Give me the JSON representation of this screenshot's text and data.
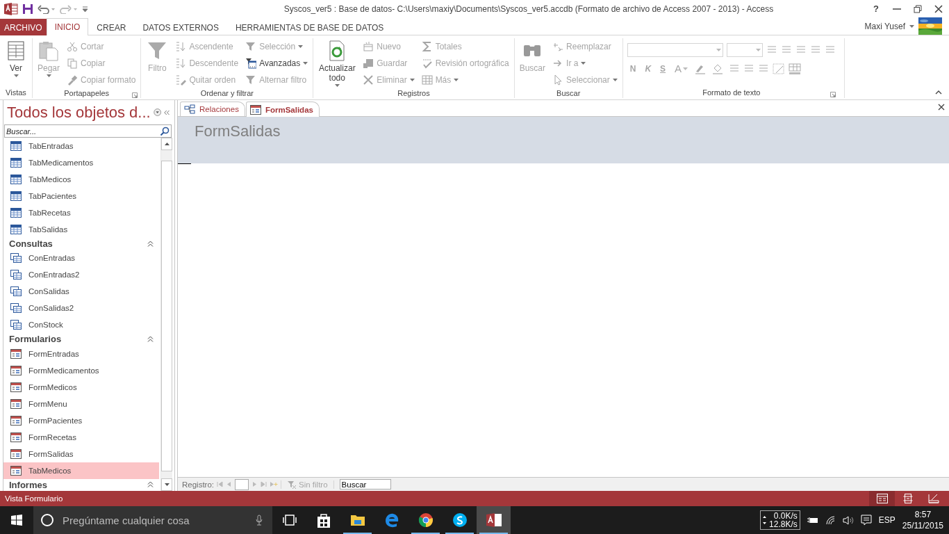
{
  "window": {
    "title": "Syscos_ver5 : Base de datos- C:\\Users\\maxiy\\Documents\\Syscos_ver5.accdb (Formato de archivo de Access 2007 - 2013) - Access",
    "help": "?"
  },
  "ribbon_tabs": [
    {
      "label": "ARCHIVO",
      "kind": "file",
      "selected": false
    },
    {
      "label": "INICIO",
      "kind": "tab",
      "selected": true
    },
    {
      "label": "CREAR",
      "kind": "tab",
      "selected": false
    },
    {
      "label": "DATOS EXTERNOS",
      "kind": "tab",
      "selected": false
    },
    {
      "label": "HERRAMIENTAS DE BASE DE DATOS",
      "kind": "tab",
      "selected": false
    }
  ],
  "user": {
    "name": "Maxi Yusef"
  },
  "ribbon_groups": [
    {
      "title": "Vistas",
      "launcher": false,
      "columns": [
        {
          "kind": "large",
          "items": [
            {
              "label": "Ver",
              "disabled": false,
              "dropdown": true
            }
          ]
        }
      ]
    },
    {
      "title": "Portapapeles",
      "launcher": true,
      "columns": [
        {
          "kind": "large",
          "items": [
            {
              "label": "Pegar",
              "disabled": true,
              "dropdown": true
            }
          ]
        },
        {
          "kind": "stack",
          "items": [
            {
              "label": "Cortar",
              "disabled": true,
              "dropdown": false
            },
            {
              "label": "Copiar",
              "disabled": true,
              "dropdown": false
            },
            {
              "label": "Copiar formato",
              "disabled": true,
              "dropdown": false
            }
          ]
        }
      ]
    },
    {
      "title": "Ordenar y filtrar",
      "launcher": false,
      "columns": [
        {
          "kind": "large",
          "items": [
            {
              "label": "Filtro",
              "disabled": true,
              "dropdown": false
            }
          ]
        },
        {
          "kind": "stack",
          "items": [
            {
              "label": "Ascendente",
              "disabled": true,
              "dropdown": false
            },
            {
              "label": "Descendente",
              "disabled": true,
              "dropdown": false
            },
            {
              "label": "Quitar orden",
              "disabled": true,
              "dropdown": false
            }
          ]
        },
        {
          "kind": "stack",
          "items": [
            {
              "label": "Selección",
              "disabled": true,
              "dropdown": true
            },
            {
              "label": "Avanzadas",
              "disabled": false,
              "dropdown": true
            },
            {
              "label": "Alternar filtro",
              "disabled": true,
              "dropdown": false
            }
          ]
        }
      ]
    },
    {
      "title": "Registros",
      "launcher": false,
      "columns": [
        {
          "kind": "large",
          "items": [
            {
              "label": "Actualizar todo",
              "disabled": false,
              "dropdown": true
            }
          ]
        },
        {
          "kind": "stack",
          "items": [
            {
              "label": "Nuevo",
              "disabled": true,
              "dropdown": false
            },
            {
              "label": "Guardar",
              "disabled": true,
              "dropdown": false
            },
            {
              "label": "Eliminar",
              "disabled": true,
              "dropdown": true
            }
          ]
        },
        {
          "kind": "stack",
          "items": [
            {
              "label": "Totales",
              "disabled": true,
              "dropdown": false
            },
            {
              "label": "Revisión ortográfica",
              "disabled": true,
              "dropdown": false
            },
            {
              "label": "Más",
              "disabled": true,
              "dropdown": true
            }
          ]
        }
      ]
    },
    {
      "title": "Buscar",
      "launcher": false,
      "columns": [
        {
          "kind": "large",
          "items": [
            {
              "label": "Buscar",
              "disabled": true,
              "dropdown": false
            }
          ]
        },
        {
          "kind": "stack",
          "items": [
            {
              "label": "Reemplazar",
              "disabled": true,
              "dropdown": false
            },
            {
              "label": "Ir a",
              "disabled": true,
              "dropdown": true
            },
            {
              "label": "Seleccionar",
              "disabled": true,
              "dropdown": true
            }
          ]
        }
      ]
    },
    {
      "title": "Formato de texto",
      "launcher": true,
      "columns": [
        {
          "kind": "format",
          "items": [
            {
              "label": "N",
              "disabled": true,
              "dropdown": false
            },
            {
              "label": "K",
              "disabled": true,
              "dropdown": false
            },
            {
              "label": "S",
              "disabled": true,
              "dropdown": false
            },
            {
              "label": "A",
              "disabled": true,
              "dropdown": true
            }
          ]
        }
      ]
    }
  ],
  "nav_pane": {
    "title": "Todos los objetos d...",
    "search": {
      "placeholder": "Buscar..."
    },
    "sections": [
      {
        "kind": "table",
        "items": [
          {
            "label": "TabEntradas",
            "selected": false
          },
          {
            "label": "TabMedicamentos",
            "selected": false
          },
          {
            "label": "TabMedicos",
            "selected": false
          },
          {
            "label": "TabPacientes",
            "selected": false
          },
          {
            "label": "TabRecetas",
            "selected": false
          },
          {
            "label": "TabSalidas",
            "selected": false
          }
        ]
      },
      {
        "title": "Consultas",
        "kind": "query",
        "expanded": true,
        "items": [
          {
            "label": "ConEntradas",
            "selected": false
          },
          {
            "label": "ConEntradas2",
            "selected": false
          },
          {
            "label": "ConSalidas",
            "selected": false
          },
          {
            "label": "ConSalidas2",
            "selected": false
          },
          {
            "label": "ConStock",
            "selected": false
          }
        ]
      },
      {
        "title": "Formularios",
        "kind": "form",
        "expanded": true,
        "items": [
          {
            "label": "FormEntradas",
            "selected": false
          },
          {
            "label": "FormMedicamentos",
            "selected": false
          },
          {
            "label": "FormMedicos",
            "selected": false
          },
          {
            "label": "FormMenu",
            "selected": false
          },
          {
            "label": "FormPacientes",
            "selected": false
          },
          {
            "label": "FormRecetas",
            "selected": false
          },
          {
            "label": "FormSalidas",
            "selected": false
          },
          {
            "label": "TabMedicos",
            "selected": true
          }
        ]
      },
      {
        "title": "Informes",
        "expanded": true
      }
    ]
  },
  "document_tabs": [
    {
      "label": "Relaciones",
      "kind": "relationships",
      "selected": false
    },
    {
      "label": "FormSalidas",
      "kind": "form",
      "selected": true
    }
  ],
  "form": {
    "title": "FormSalidas"
  },
  "record_nav": {
    "label": "Registro:",
    "filter": {
      "label": "Sin filtro",
      "disabled": true
    },
    "search": {
      "value": "Buscar"
    }
  },
  "status_bar": {
    "text": "Vista Formulario",
    "views": [
      {
        "kind": "form",
        "selected": true
      },
      {
        "kind": "layout",
        "selected": false
      },
      {
        "kind": "design",
        "selected": false
      }
    ]
  },
  "taskbar": {
    "search": {
      "placeholder": "Pregúntame cualquier cosa"
    },
    "apps": [
      {
        "kind": "store",
        "running": false,
        "selected": false
      },
      {
        "kind": "explorer",
        "running": true,
        "selected": false
      },
      {
        "kind": "edge",
        "running": false,
        "selected": false
      },
      {
        "kind": "chrome",
        "running": true,
        "selected": false
      },
      {
        "kind": "skype",
        "running": true,
        "selected": false
      },
      {
        "kind": "access",
        "running": true,
        "selected": true
      }
    ],
    "net": {
      "up": "0.0K/s",
      "down": "12.8K/s"
    },
    "language": "ESP",
    "time": "8:57",
    "date": "25/11/2015"
  }
}
